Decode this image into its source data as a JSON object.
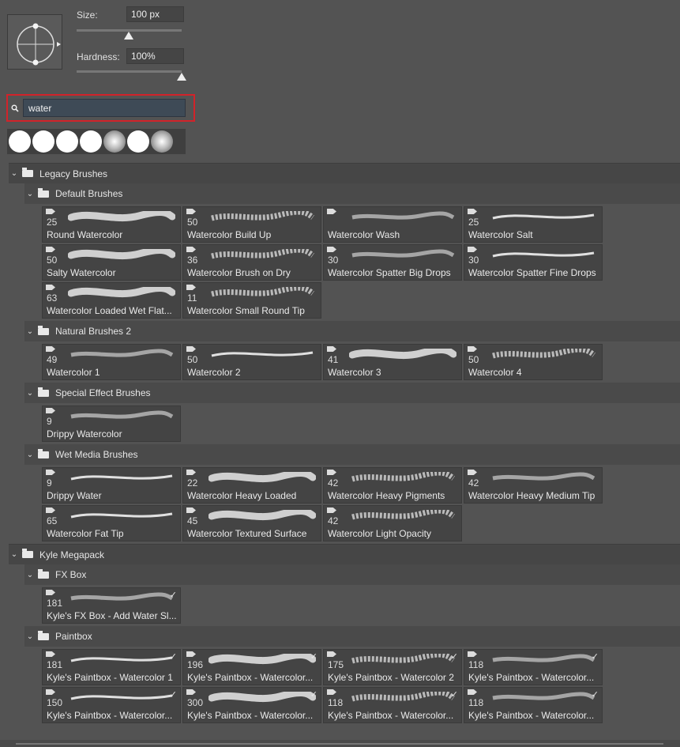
{
  "brush_settings": {
    "size_label": "Size:",
    "size_value": "100 px",
    "hardness_label": "Hardness:",
    "hardness_value": "100%"
  },
  "search": {
    "value": "water"
  },
  "groups": [
    {
      "name": "Legacy Brushes",
      "subgroups": [
        {
          "name": "Default Brushes",
          "brushes": [
            {
              "size": "25",
              "name": "Round Watercolor"
            },
            {
              "size": "50",
              "name": "Watercolor Build Up"
            },
            {
              "size": "",
              "name": "Watercolor Wash"
            },
            {
              "size": "25",
              "name": "Watercolor Salt"
            },
            {
              "size": "50",
              "name": "Salty Watercolor"
            },
            {
              "size": "36",
              "name": "Watercolor Brush on Dry"
            },
            {
              "size": "30",
              "name": "Watercolor Spatter Big Drops"
            },
            {
              "size": "30",
              "name": "Watercolor Spatter Fine Drops"
            },
            {
              "size": "63",
              "name": "Watercolor Loaded Wet Flat..."
            },
            {
              "size": "11",
              "name": "Watercolor Small Round Tip"
            }
          ]
        },
        {
          "name": "Natural Brushes 2",
          "brushes": [
            {
              "size": "49",
              "name": "Watercolor 1"
            },
            {
              "size": "50",
              "name": "Watercolor 2"
            },
            {
              "size": "41",
              "name": "Watercolor 3"
            },
            {
              "size": "50",
              "name": "Watercolor 4"
            }
          ]
        },
        {
          "name": "Special Effect Brushes",
          "brushes": [
            {
              "size": "9",
              "name": "Drippy Watercolor"
            }
          ]
        },
        {
          "name": "Wet Media Brushes",
          "brushes": [
            {
              "size": "9",
              "name": "Drippy Water"
            },
            {
              "size": "22",
              "name": "Watercolor Heavy Loaded"
            },
            {
              "size": "42",
              "name": "Watercolor Heavy Pigments"
            },
            {
              "size": "42",
              "name": "Watercolor Heavy Medium Tip"
            },
            {
              "size": "65",
              "name": "Watercolor Fat Tip"
            },
            {
              "size": "45",
              "name": "Watercolor Textured Surface"
            },
            {
              "size": "42",
              "name": "Watercolor Light Opacity"
            }
          ]
        }
      ]
    },
    {
      "name": "Kyle Megapack",
      "subgroups": [
        {
          "name": "FX Box",
          "brushes": [
            {
              "size": "181",
              "name": "Kyle's FX Box - Add Water Sl..."
            }
          ]
        },
        {
          "name": "Paintbox",
          "brushes": [
            {
              "size": "181",
              "name": "Kyle's Paintbox - Watercolor 1"
            },
            {
              "size": "196",
              "name": "Kyle's Paintbox - Watercolor..."
            },
            {
              "size": "175",
              "name": "Kyle's Paintbox - Watercolor 2"
            },
            {
              "size": "118",
              "name": "Kyle's Paintbox - Watercolor..."
            },
            {
              "size": "150",
              "name": "Kyle's Paintbox - Watercolor..."
            },
            {
              "size": "300",
              "name": "Kyle's Paintbox - Watercolor..."
            },
            {
              "size": "118",
              "name": "Kyle's Paintbox - Watercolor..."
            },
            {
              "size": "118",
              "name": "Kyle's Paintbox - Watercolor..."
            }
          ]
        }
      ]
    }
  ],
  "icons": {
    "search": "search-icon",
    "folder": "folder-icon",
    "chevron": "chevron-down-icon",
    "edit": "brush-edit-icon"
  },
  "colors": {
    "panel_bg": "#535353",
    "highlight_red": "#d2232a"
  }
}
